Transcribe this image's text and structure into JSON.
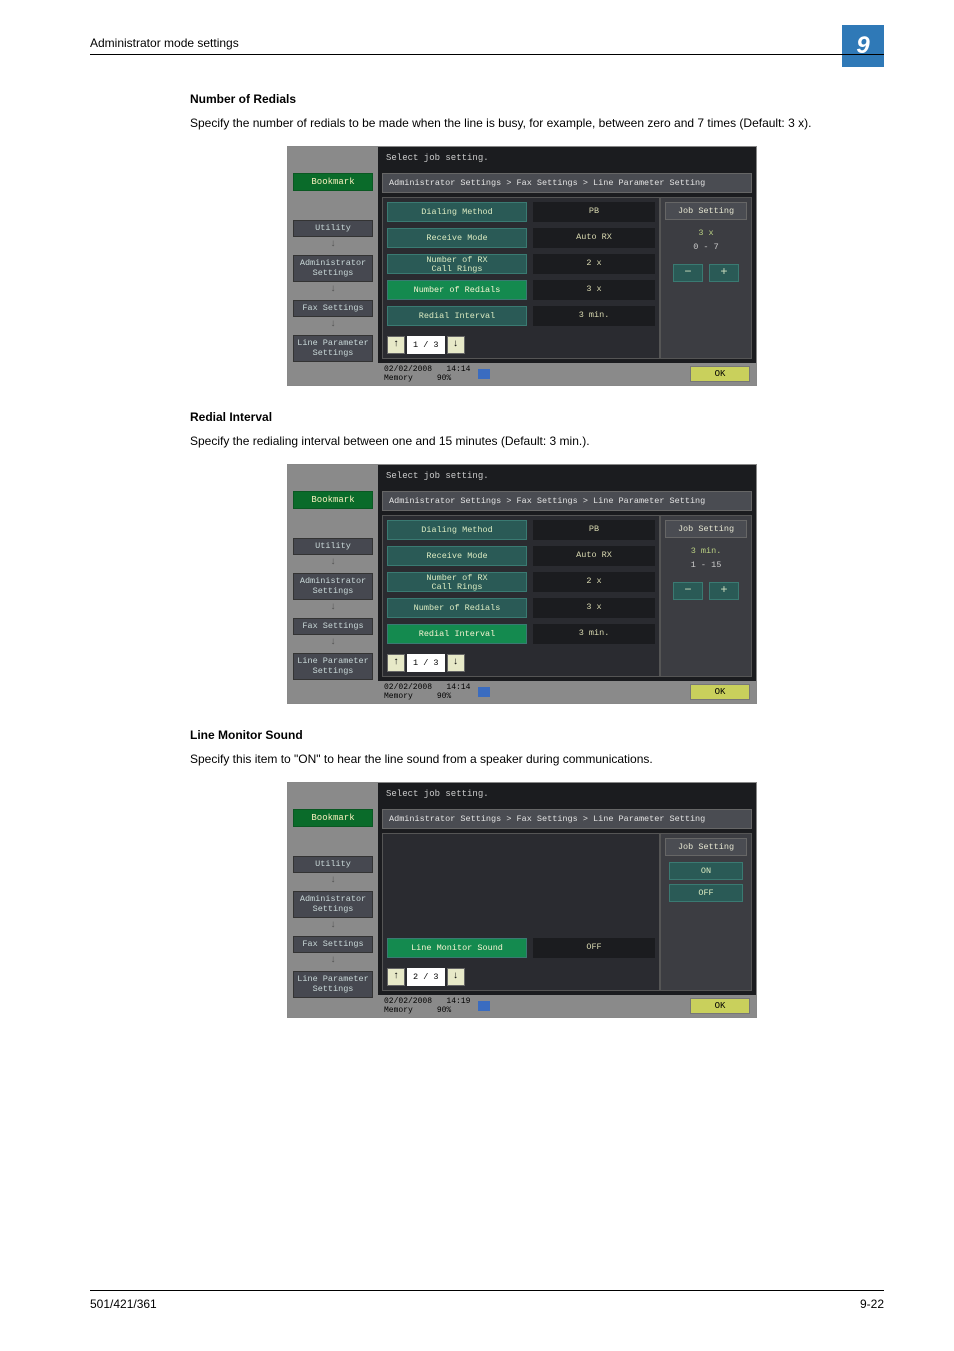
{
  "header": {
    "section": "Administrator mode settings",
    "chapter": "9"
  },
  "sections": {
    "redials": {
      "title": "Number of Redials",
      "body": "Specify the number of redials to be made when the line is busy, for example, between zero and 7 times (Default: 3 x)."
    },
    "interval": {
      "title": "Redial Interval",
      "body": "Specify the redialing interval between one and 15 minutes (Default: 3 min.)."
    },
    "monitor": {
      "title": "Line Monitor Sound",
      "body": "Specify this item to \"ON\" to hear the line sound from a speaker during communications."
    }
  },
  "panel": {
    "prompt": "Select job setting.",
    "breadcrumb": "Administrator Settings  >  Fax Settings  >  Line Parameter Setting",
    "bookmark": "Bookmark",
    "sidebar": {
      "utility": "Utility",
      "admin": "Administrator\nSettings",
      "fax": "Fax Settings",
      "line": "Line Parameter\nSettings"
    },
    "rows": {
      "dialing": {
        "label": "Dialing Method",
        "value": "PB"
      },
      "receive": {
        "label": "Receive Mode",
        "value": "Auto RX"
      },
      "rxcalls": {
        "label": "Number of RX\nCall Rings",
        "value": "2  x"
      },
      "redials": {
        "label": "Number of Redials",
        "value": "3  x"
      },
      "interval": {
        "label": "Redial Interval",
        "value": "3  min."
      },
      "monitor": {
        "label": "Line Monitor Sound",
        "value": "OFF"
      }
    },
    "job": {
      "title": "Job Setting",
      "redials_val": "3  x",
      "redials_range": "0  -  7",
      "interval_val": "3  min.",
      "interval_range": "1  -  15",
      "on": "ON",
      "off": "OFF"
    },
    "page1": "1 /  3",
    "page2": "2 /  3",
    "status": {
      "date": "02/02/2008",
      "time1": "14:14",
      "time3": "14:19",
      "memlabel": "Memory",
      "mem": "90%"
    },
    "ok": "OK"
  },
  "footer": {
    "left": "501/421/361",
    "right": "9-22"
  }
}
